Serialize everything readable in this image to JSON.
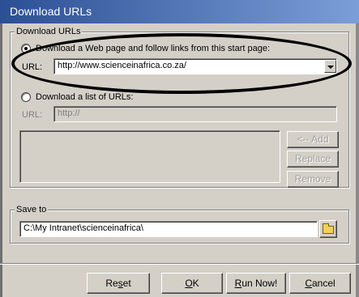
{
  "window": {
    "title": "Download URLs"
  },
  "download_group": {
    "legend": "Download URLs",
    "option_web_page": "Download a Web page and follow links from this start page:",
    "option_web_page_checked": true,
    "url_label": "URL:",
    "url_value": "http://www.scienceinafrica.co.za/",
    "option_list": "Download a list of URLs:",
    "option_list_checked": false,
    "list_url_label": "URL:",
    "list_url_placeholder": "http://",
    "add_button": "<-- Add",
    "replace_button": "Replace",
    "remove_button": "Remove"
  },
  "save_group": {
    "legend": "Save to",
    "path_value": "C:\\My Intranet\\scienceinafrica\\"
  },
  "footer": {
    "reset": {
      "pre": "Re",
      "u": "s",
      "post": "et"
    },
    "ok": {
      "pre": "",
      "u": "O",
      "post": "K"
    },
    "run": {
      "pre": "",
      "u": "R",
      "post": "un Now!"
    },
    "cancel": {
      "pre": "",
      "u": "C",
      "post": "ancel"
    }
  },
  "icons": {
    "dropdown": "chevron-down-icon",
    "browse": "folder-icon"
  },
  "colors": {
    "face": "#d4d0c8",
    "title_start": "#2b4f94",
    "title_end": "#7b9ed8"
  }
}
